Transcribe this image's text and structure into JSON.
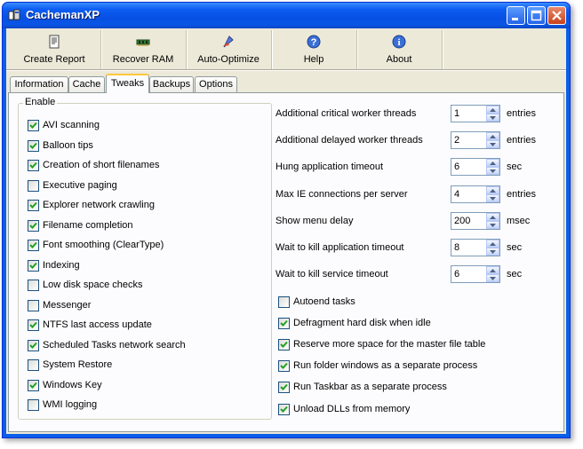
{
  "window": {
    "title": "CachemanXP"
  },
  "toolbar": [
    {
      "label": "Create Report",
      "icon": "report-icon"
    },
    {
      "label": "Recover RAM",
      "icon": "memory-chip-icon"
    },
    {
      "label": "Auto-Optimize",
      "icon": "optimize-icon"
    },
    {
      "label": "Help",
      "icon": "help-icon"
    },
    {
      "label": "About",
      "icon": "info-icon"
    }
  ],
  "tabs": [
    {
      "label": "Information",
      "active": false
    },
    {
      "label": "Cache",
      "active": false
    },
    {
      "label": "Tweaks",
      "active": true
    },
    {
      "label": "Backups",
      "active": false
    },
    {
      "label": "Options",
      "active": false
    }
  ],
  "enable_group": {
    "title": "Enable",
    "items": [
      {
        "label": "AVI scanning",
        "checked": true
      },
      {
        "label": "Balloon tips",
        "checked": true
      },
      {
        "label": "Creation of short filenames",
        "checked": true
      },
      {
        "label": "Executive paging",
        "checked": false
      },
      {
        "label": "Explorer network crawling",
        "checked": true
      },
      {
        "label": "Filename completion",
        "checked": true
      },
      {
        "label": "Font smoothing (ClearType)",
        "checked": true
      },
      {
        "label": "Indexing",
        "checked": true
      },
      {
        "label": "Low disk space checks",
        "checked": false
      },
      {
        "label": "Messenger",
        "checked": false
      },
      {
        "label": "NTFS last access update",
        "checked": true
      },
      {
        "label": "Scheduled Tasks network search",
        "checked": true
      },
      {
        "label": "System Restore",
        "checked": false
      },
      {
        "label": "Windows Key",
        "checked": true
      },
      {
        "label": "WMI logging",
        "checked": false
      }
    ]
  },
  "settings": [
    {
      "label": "Additional critical worker threads",
      "value": "1",
      "unit": "entries"
    },
    {
      "label": "Additional delayed worker threads",
      "value": "2",
      "unit": "entries"
    },
    {
      "label": "Hung application timeout",
      "value": "6",
      "unit": "sec"
    },
    {
      "label": "Max IE connections per server",
      "value": "4",
      "unit": "entries"
    },
    {
      "label": "Show menu delay",
      "value": "200",
      "unit": "msec"
    },
    {
      "label": "Wait to kill application timeout",
      "value": "8",
      "unit": "sec"
    },
    {
      "label": "Wait to kill service timeout",
      "value": "6",
      "unit": "sec"
    }
  ],
  "options": [
    {
      "label": "Autoend tasks",
      "checked": false
    },
    {
      "label": "Defragment hard disk when idle",
      "checked": true
    },
    {
      "label": "Reserve more space for the master file table",
      "checked": true
    },
    {
      "label": "Run folder windows as a separate process",
      "checked": true
    },
    {
      "label": "Run Taskbar as a separate process",
      "checked": true
    },
    {
      "label": "Unload DLLs from memory",
      "checked": true
    }
  ],
  "colors": {
    "title_bar": "#0a56e6",
    "tab_highlight": "#ffc83c",
    "check": "#21a121"
  }
}
